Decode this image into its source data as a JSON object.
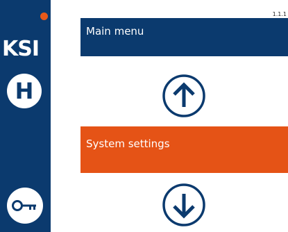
{
  "sidebar": {
    "brand": "KSI",
    "home_label": "H",
    "icons": {
      "status": "status-dot-icon",
      "key": "key-icon"
    }
  },
  "header": {
    "version": "1.1.1"
  },
  "menu": {
    "current_title": "Main menu",
    "selected_item": "System settings",
    "up_icon": "arrow-up-icon",
    "down_icon": "arrow-down-icon"
  },
  "colors": {
    "primary_blue": "#0b3a6e",
    "accent_orange": "#e55316",
    "status_dot": "#e8591a",
    "background": "#ffffff"
  }
}
